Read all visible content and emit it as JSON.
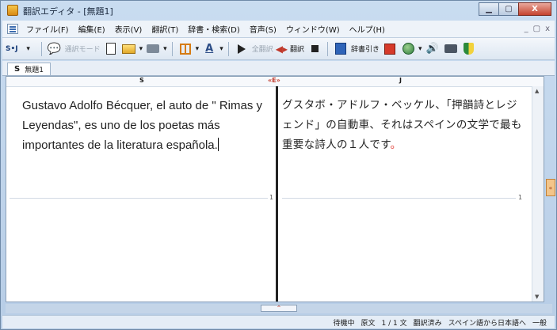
{
  "window": {
    "title": "翻訳エディタ - [無題1]",
    "buttons": {
      "minimize": "▁",
      "maximize": "▢",
      "close": "X"
    }
  },
  "menubar": {
    "items": [
      "ファイル(F)",
      "編集(E)",
      "表示(V)",
      "翻訳(T)",
      "辞書・検索(D)",
      "音声(S)",
      "ウィンドウ(W)",
      "ヘルプ(H)"
    ],
    "mdi": [
      "_",
      "▢",
      "x"
    ]
  },
  "toolbar": {
    "lang_button": "S•J",
    "interpret_mode": "通訳モード",
    "full_translate": "全翻訳",
    "translate": "翻訳",
    "dictionary_lookup": "辞書引き"
  },
  "tabs": {
    "pane_marker": "S",
    "doc_tab": "無題1"
  },
  "ruler": {
    "source": "S",
    "center": "«E»",
    "target": "J"
  },
  "editor": {
    "source_text": "Gustavo Adolfo Bécquer, el auto de \" Rimas y Leyendas\", es uno de los poetas más importantes de la literatura española.",
    "target_text": "グスタボ・アドルフ・ベッケル、「押韻詩とレジェンド」の自動車、それはスペインの文学で最も重要な詩人の１人です",
    "target_end_mark": "。",
    "source_segment": "1",
    "target_segment": "1"
  },
  "side_tab": "«",
  "splitter_arrow": "⌃",
  "status": {
    "state": "待機中",
    "mode": "原文",
    "sentence_count": "1 / 1 文",
    "translated": "翻訳済み",
    "direction": "スペイン語から日本語へ",
    "category": "一般"
  },
  "colors": {
    "accent": "#3d6db0",
    "divider": "#222222",
    "end_mark": "#e0332a"
  }
}
